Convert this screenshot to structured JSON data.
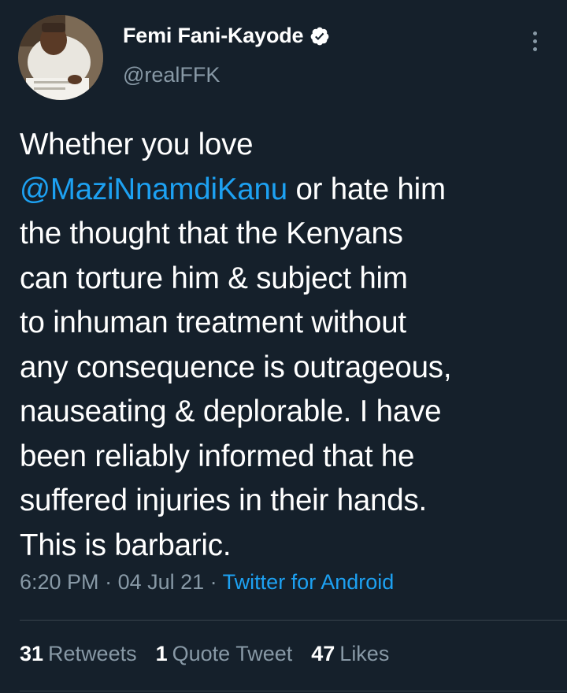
{
  "user": {
    "display_name": "Femi Fani-Kayode",
    "handle": "@realFFK",
    "verified": true,
    "avatar_icon": "profile-photo"
  },
  "tweet": {
    "lines": [
      [
        {
          "t": "Whether you love",
          "m": false
        }
      ],
      [
        {
          "t": "@MaziNnamdiKanu",
          "m": true
        },
        {
          "t": " or hate him",
          "m": false
        }
      ],
      [
        {
          "t": "the thought that the Kenyans",
          "m": false
        }
      ],
      [
        {
          "t": "can torture him & subject him",
          "m": false
        }
      ],
      [
        {
          "t": "to inhuman treatment without",
          "m": false
        }
      ],
      [
        {
          "t": "any consequence is outrageous,",
          "m": false
        }
      ],
      [
        {
          "t": "nauseating & deplorable. I have",
          "m": false
        }
      ],
      [
        {
          "t": "been reliably informed that he",
          "m": false
        }
      ],
      [
        {
          "t": "suffered injuries in their hands.",
          "m": false
        }
      ],
      [
        {
          "t": "This is barbaric.",
          "m": false
        }
      ]
    ],
    "time": "6:20 PM",
    "date": "04 Jul 21",
    "separator": " · ",
    "source": "Twitter for Android"
  },
  "stats": {
    "retweets": {
      "count": "31",
      "label": "Retweets"
    },
    "quotes": {
      "count": "1",
      "label": "Quote Tweet"
    },
    "likes": {
      "count": "47",
      "label": "Likes"
    }
  },
  "colors": {
    "background": "#15202b",
    "text": "#ffffff",
    "secondary": "#8899a6",
    "link": "#1da1f2",
    "divider": "#38444d"
  },
  "icons": {
    "verified": "verified-badge-icon",
    "more": "more-vertical-icon"
  }
}
